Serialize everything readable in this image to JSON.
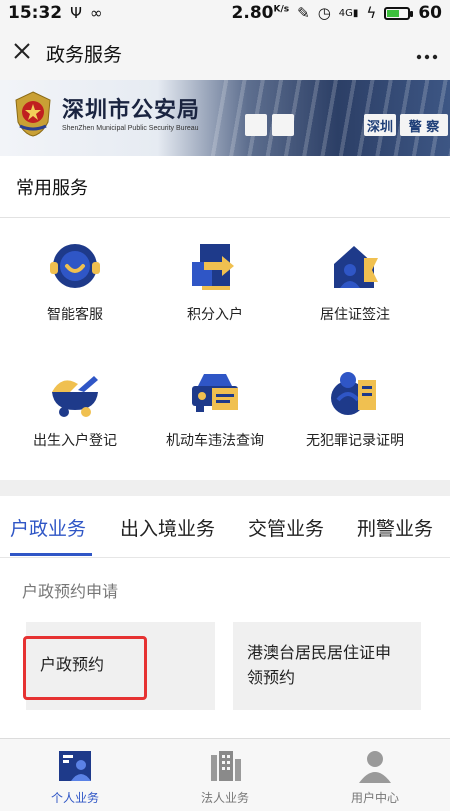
{
  "status_bar": {
    "time": "15:32",
    "speed": "2.80",
    "speed_unit": "K/s",
    "network": "4G",
    "battery": "60",
    "battery_level": 0.6
  },
  "nav": {
    "close_icon": "close-icon",
    "title": "政务服务",
    "more_icon": "more-icon"
  },
  "banner": {
    "title": "深圳市公安局",
    "subtitle": "ShenZhen Municipal Public Security Bureau",
    "sign_1": "深圳",
    "sign_2": "警 察"
  },
  "common_services": {
    "title": "常用服务",
    "items": [
      {
        "label": "智能客服",
        "icon": "smart-service-icon"
      },
      {
        "label": "积分入户",
        "icon": "points-household-icon"
      },
      {
        "label": "居住证签注",
        "icon": "residence-permit-icon"
      },
      {
        "label": "出生入户登记",
        "icon": "birth-registration-icon"
      },
      {
        "label": "机动车违法查询",
        "icon": "vehicle-violation-icon"
      },
      {
        "label": "无犯罪记录证明",
        "icon": "no-criminal-record-icon"
      }
    ]
  },
  "business_tabs": {
    "tabs": [
      {
        "label": "户政业务",
        "active": true
      },
      {
        "label": "出入境业务",
        "active": false
      },
      {
        "label": "交管业务",
        "active": false
      },
      {
        "label": "刑警业务",
        "active": false
      }
    ],
    "sub_heading": "户政预约申请",
    "cards": [
      {
        "label": "户政预约"
      },
      {
        "label_line_1": "港澳台居民居住证申",
        "label_line_2": "领预约"
      }
    ]
  },
  "bottom_nav": {
    "items": [
      {
        "label": "个人业务",
        "icon": "person-business-icon",
        "active": true
      },
      {
        "label": "法人业务",
        "icon": "building-icon",
        "active": false
      },
      {
        "label": "用户中心",
        "icon": "user-icon",
        "active": false
      }
    ]
  },
  "colors": {
    "accent": "#2f56c6",
    "icon_navy": "#1e3a8a",
    "icon_gold": "#e0b04a",
    "highlight": "#e63232"
  }
}
